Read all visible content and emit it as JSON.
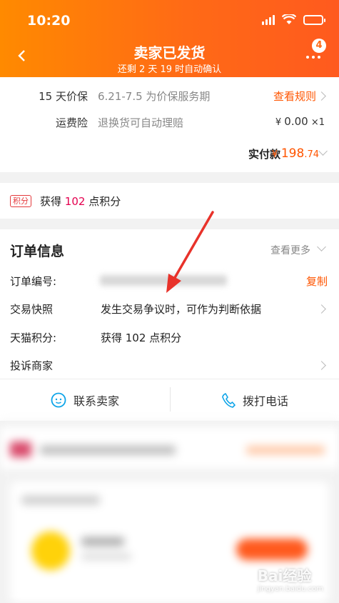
{
  "status_bar": {
    "time": "10:20"
  },
  "header": {
    "title": "卖家已发货",
    "subtitle": "还剩 2 天 19 时自动确认",
    "badge_count": "4"
  },
  "price_card": {
    "price_protect": {
      "label": "15 天价保",
      "desc": "6.21-7.5 为价保服务期",
      "link": "查看规则"
    },
    "shipping_insurance": {
      "label": "运费险",
      "desc": "退换货可自动理赔",
      "currency": "¥",
      "amount": "0.00",
      "qty": "×1"
    },
    "paid": {
      "label": "实付款",
      "currency": "¥",
      "amount_int": "198",
      "amount_dec": ".74"
    }
  },
  "points_card": {
    "tag": "积分",
    "prefix": "获得",
    "points": "102",
    "suffix": "点积分"
  },
  "order_info": {
    "title": "订单信息",
    "more": "查看更多",
    "order_no_label": "订单编号:",
    "copy": "复制",
    "snapshot_label": "交易快照",
    "snapshot_desc": "发生交易争议时，可作为判断依据",
    "tmall_points_label": "天猫积分:",
    "tmall_points_value": "获得 102 点积分",
    "complain_label": "投诉商家",
    "contact_seller": "联系卖家",
    "call_phone": "拨打电话"
  },
  "watermark": {
    "text": "Bai经验",
    "sub": "jingyan.baidu.com"
  },
  "colors": {
    "accent": "#ff5500",
    "header_start": "#ff8a00",
    "header_end": "#ff5a1e",
    "annotation_arrow": "#e8322a"
  }
}
